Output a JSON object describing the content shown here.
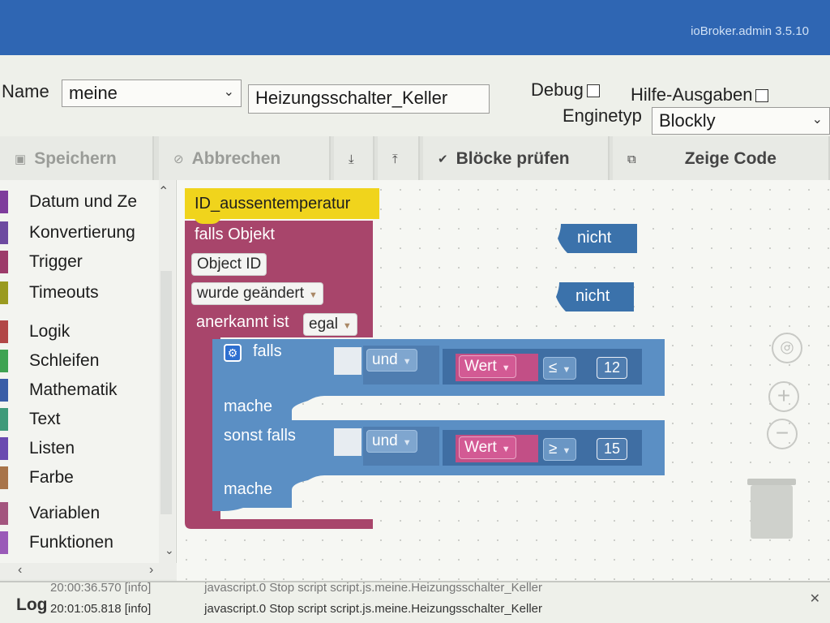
{
  "app": {
    "version": "ioBroker.admin 3.5.10"
  },
  "form": {
    "name_label": "Name",
    "folder_value": "meine",
    "script_name": "Heizungsschalter_Keller",
    "debug_label": "Debug",
    "help_label": "Hilfe-Ausgaben",
    "engine_label": "Enginetyp",
    "engine_value": "Blockly"
  },
  "toolbar": {
    "save": "Speichern",
    "cancel": "Abbrechen",
    "check": "Blöcke prüfen",
    "show_code": "Zeige Code"
  },
  "sidebar": {
    "items": [
      {
        "label": "Datum und Ze",
        "color": "#7e3c9c"
      },
      {
        "label": "Konvertierung",
        "color": "#6d4aa0"
      },
      {
        "label": "Trigger",
        "color": "#9c3b6a"
      },
      {
        "label": "Timeouts",
        "color": "#9a9a20"
      },
      {
        "label": "Logik",
        "color": "#b24747"
      },
      {
        "label": "Schleifen",
        "color": "#3fa352"
      },
      {
        "label": "Mathematik",
        "color": "#3a5ea7"
      },
      {
        "label": "Text",
        "color": "#3f9a7a"
      },
      {
        "label": "Listen",
        "color": "#6a4ab0"
      },
      {
        "label": "Farbe",
        "color": "#a8744a"
      },
      {
        "label": "Variablen",
        "color": "#a3557e"
      },
      {
        "label": "Funktionen",
        "color": "#9a5ab8"
      }
    ]
  },
  "blocks": {
    "id_block": "ID_aussentemperatur",
    "trigger_title": "falls Objekt",
    "object_id": "Object ID",
    "changed": "wurde geändert",
    "ack_label": "anerkannt ist",
    "ack_value": "egal",
    "if_label": "falls",
    "and1": "und",
    "value1": "Wert",
    "op1": "≤",
    "num1": "12",
    "do1": "mache",
    "elseif": "sonst falls",
    "and2": "und",
    "value2": "Wert",
    "op2": "≥",
    "num2": "15",
    "do2": "mache",
    "not1": "nicht",
    "not2": "nicht"
  },
  "log": {
    "title": "Log",
    "rows": [
      {
        "time": "20:00:36.570",
        "level": "[info]",
        "msg": "javascript.0 Stop script script.js.meine.Heizungsschalter_Keller"
      },
      {
        "time": "20:01:05.818",
        "level": "[info]",
        "msg": "javascript.0 Stop script script.js.meine.Heizungsschalter_Keller"
      }
    ]
  },
  "colors": {
    "trigger": "#a8456b",
    "logic": "#5b8fc4",
    "id": "#f0d41c",
    "not": "#3b72ab"
  }
}
